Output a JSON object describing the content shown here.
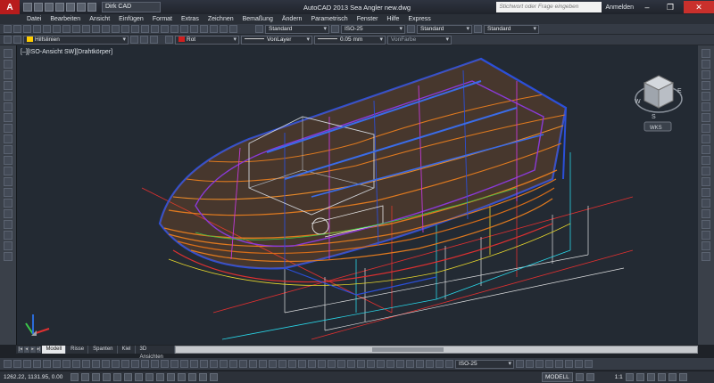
{
  "app": {
    "window_title": "AutoCAD 2013   Sea Angler new.dwg",
    "logo": "A",
    "workspace": "Dirk CAD",
    "search_placeholder": "Stichwort oder Frage eingeben",
    "login": "Anmelden"
  },
  "menu": [
    "Datei",
    "Bearbeiten",
    "Ansicht",
    "Einfügen",
    "Format",
    "Extras",
    "Zeichnen",
    "Bemaßung",
    "Ändern",
    "Parametrisch",
    "Fenster",
    "Hilfe",
    "Express"
  ],
  "toolbar1": {
    "text_style": "Standard",
    "dim_style": "ISO-25",
    "table_style": "Standard",
    "multileader_style": "Standard"
  },
  "toolbar2": {
    "layer": "Hilfslinien",
    "color": "Rot",
    "color_hex": "#d11f1f",
    "linetype": "VonLayer",
    "lineweight": "0.05 mm",
    "plotstyle": "VonFarbe"
  },
  "viewport": {
    "label": "[–][ISO-Ansicht SW][Drahtkörper]",
    "viewcube_wcs": "WKS"
  },
  "layout_tabs": [
    "Modell",
    "Risse",
    "Spanten",
    "Kiel",
    "3D Ansichten"
  ],
  "layout_active": "Modell",
  "toolbar3": {
    "dim_style": "ISO-25"
  },
  "status": {
    "coordinates": "1262.22, 1131.95, 0.00",
    "space": "MODELL",
    "scale": "1:1"
  },
  "colors": {
    "background": "#232a33",
    "hull_orange": "#e07a1f",
    "hull_blue": "#2b4fd8",
    "accent_red": "#d11f1f"
  }
}
